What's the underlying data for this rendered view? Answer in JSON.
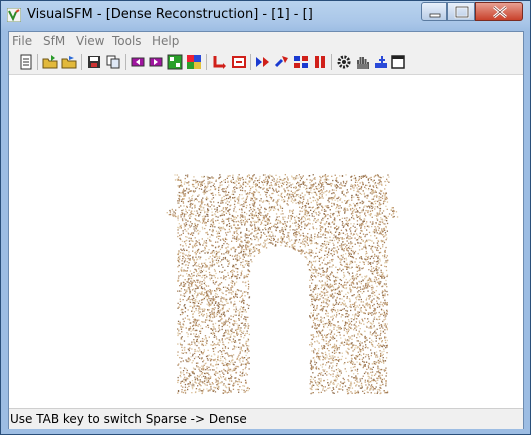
{
  "window": {
    "title": "VisualSFM - [Dense Reconstruction] - [1] - []",
    "controls": [
      "minimize-icon",
      "maximize-icon",
      "close-icon"
    ]
  },
  "menubar": {
    "items": [
      "File",
      "SfM",
      "View",
      "Tools",
      "Help"
    ]
  },
  "toolbar": {
    "icons": [
      "log-icon",
      "open-multi-images-icon",
      "open-folder-icon",
      "save-icon",
      "copy-icon",
      "model-prev-icon",
      "model-next-icon",
      "match-icon",
      "color-grid-icon",
      "show-cameras-icon",
      "pause-icon",
      "compute-3d-icon",
      "dense-icon",
      "pairwise-icon",
      "stop-icon",
      "settings-gear-icon",
      "hand-pan-icon",
      "zoom-icon",
      "window-icon"
    ]
  },
  "viewport": {
    "content": "dense-point-cloud",
    "point_color": "#c9a57a"
  },
  "status": {
    "text": "Use TAB key to switch Sparse -> Dense"
  },
  "colors": {
    "titlebar": "#b9d3ee",
    "close_button": "#c8412b",
    "menu_text": "#7a7a7a"
  }
}
